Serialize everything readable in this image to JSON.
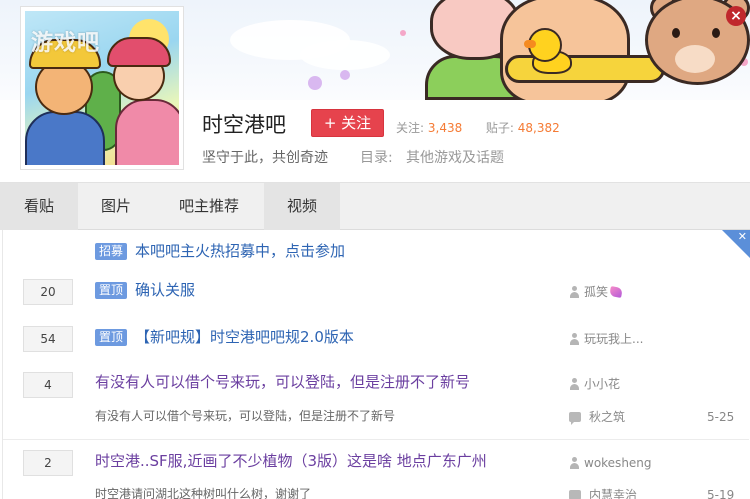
{
  "banner": {
    "close_symbol": "×"
  },
  "forum": {
    "name": "时空港吧",
    "follow_label": "+ 关注",
    "stats_follow_label": "关注:",
    "stats_follow_value": "3,438",
    "stats_posts_label": "贴子:",
    "stats_posts_value": "48,382",
    "slogan": "坚守于此，共创奇迹",
    "directory_label": "目录:",
    "directory_value": "其他游戏及话题",
    "avatar_watermark": "游戏吧"
  },
  "tabs": [
    {
      "label": "看贴",
      "active": true
    },
    {
      "label": "图片",
      "active": false
    },
    {
      "label": "吧主推荐",
      "active": false
    },
    {
      "label": "视频",
      "active": true
    }
  ],
  "threads": {
    "recruit": {
      "badge": "招募",
      "title": "本吧吧主火热招募中，点击参加"
    },
    "items": [
      {
        "replies": "20",
        "badge": "置顶",
        "title": "确认关服",
        "author": "孤笑"
      },
      {
        "replies": "54",
        "badge": "置顶",
        "title": "【新吧规】时空港吧吧规2.0版本",
        "author": "玩玩我上..."
      },
      {
        "replies": "4",
        "title": "有没有人可以借个号来玩，可以登陆，但是注册不了新号",
        "abstract": "有没有人可以借个号来玩，可以登陆，但是注册不了新号",
        "author": "小小花",
        "last_reply": "秋之筑",
        "date": "5-25"
      },
      {
        "replies": "2",
        "title": "时空港..SF服,近画了不少植物（3版）这是啥 地点广东广州",
        "abstract": "时空港请问湖北这种树叫什么树，谢谢了",
        "author": "wokesheng",
        "last_reply": "内慧幸治",
        "date": "5-19"
      }
    ]
  },
  "colors": {
    "follow_button": "#e6434d",
    "link_blue": "#2d64b3",
    "link_purple": "#6b3fa0",
    "badge_blue": "#6d9ae0",
    "stat_orange": "#f57b35"
  }
}
